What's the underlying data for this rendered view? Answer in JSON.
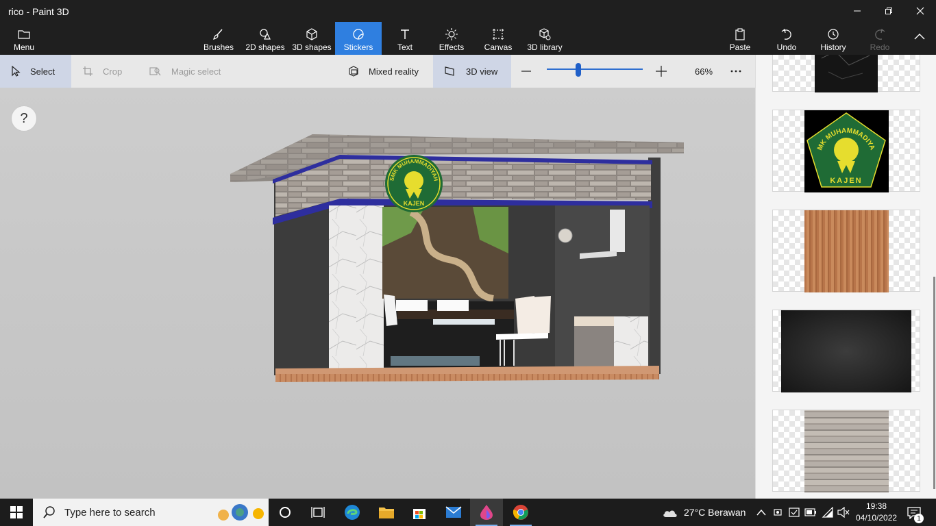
{
  "app": {
    "title": "rico - Paint 3D"
  },
  "ribbon": {
    "menu": "Menu",
    "tools": [
      "Brushes",
      "2D shapes",
      "3D shapes",
      "Stickers",
      "Text",
      "Effects",
      "Canvas",
      "3D library"
    ],
    "active_tool": "Stickers",
    "paste": "Paste",
    "undo": "Undo",
    "history": "History",
    "redo": "Redo"
  },
  "toolbar": {
    "select": "Select",
    "crop": "Crop",
    "magic_select": "Magic select",
    "mixed_reality": "Mixed reality",
    "view_3d": "3D view",
    "zoom": "66%",
    "zoom_fraction": 0.33
  },
  "canvas": {
    "help": "?",
    "logo_top": "SMK MUHAMMADIYAH",
    "logo_bottom": "KAJEN"
  },
  "stickers": [
    {
      "name": "dark marble texture"
    },
    {
      "name": "SMK Muhammadiyah Kajen logo",
      "logo_top": "SMK MUHAMMADIYAH",
      "logo_bottom": "KAJEN"
    },
    {
      "name": "wood texture"
    },
    {
      "name": "dark slate texture"
    },
    {
      "name": "stone wall texture"
    }
  ],
  "taskbar": {
    "search_placeholder": "Type here to search",
    "weather": "27°C  Berawan",
    "time": "19:38",
    "date": "04/10/2022",
    "notification_count": "1"
  },
  "colors": {
    "accent": "#2f7fe0",
    "titlebar": "#1f1f1f",
    "toolbar": "#e8e8e8"
  }
}
